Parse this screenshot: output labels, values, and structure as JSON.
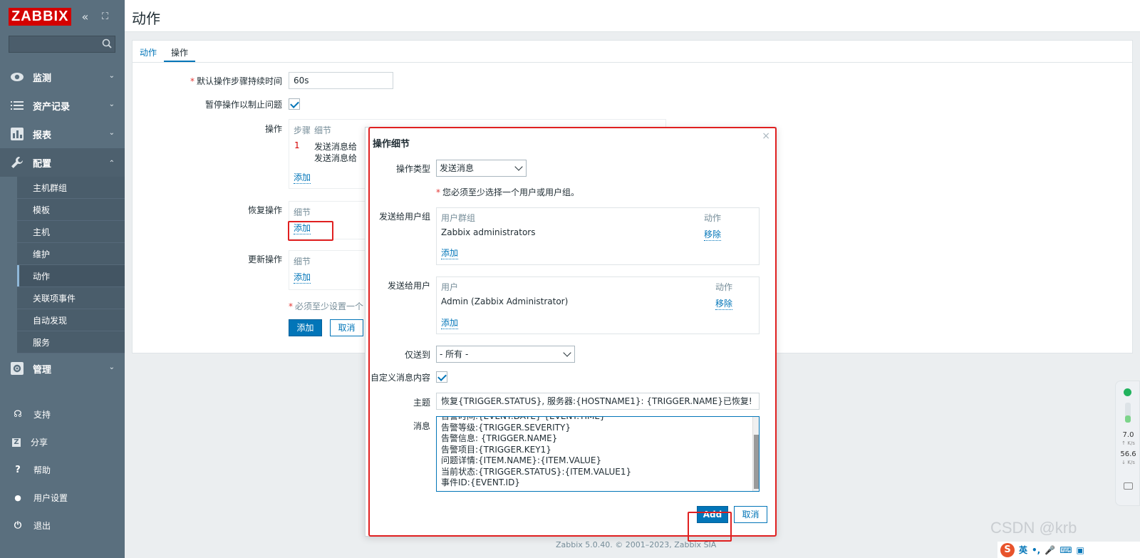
{
  "sidebar": {
    "logo": "ZABBIX",
    "collapse_glyph": "«",
    "kiosk_glyph": "⛶",
    "search_placeholder": "",
    "nav": [
      {
        "label": "监测",
        "icon": "eye-icon"
      },
      {
        "label": "资产记录",
        "icon": "list-icon"
      },
      {
        "label": "报表",
        "icon": "bar-chart-icon"
      },
      {
        "label": "配置",
        "icon": "wrench-icon"
      }
    ],
    "config_sub": [
      "主机群组",
      "模板",
      "主机",
      "维护",
      "动作",
      "关联项事件",
      "自动发现",
      "服务"
    ],
    "admin": {
      "label": "管理",
      "icon": "gear-icon"
    },
    "bottom": [
      {
        "label": "支持",
        "icon": "headset-icon",
        "glyph": "☊"
      },
      {
        "label": "分享",
        "icon": "share-z-icon",
        "glyph": "Z"
      },
      {
        "label": "帮助",
        "icon": "help-icon",
        "glyph": "?"
      },
      {
        "label": "用户设置",
        "icon": "user-icon",
        "glyph": "●"
      },
      {
        "label": "退出",
        "icon": "power-icon",
        "glyph": "⏻"
      }
    ]
  },
  "page": {
    "title": "动作"
  },
  "tabs": [
    {
      "label": "动作"
    },
    {
      "label": "操作"
    }
  ],
  "form": {
    "duration_label": "默认操作步骤持续时间",
    "duration_value": "60s",
    "pause_label": "暂停操作以制止问题",
    "ops_label": "操作",
    "ops_col_step": "步骤",
    "ops_col_detail": "细节",
    "ops_row_num": "1",
    "ops_row_line1": "发送消息给",
    "ops_row_line2": "发送消息给",
    "add_link": "添加",
    "recovery_label": "恢复操作",
    "update_label": "更新操作",
    "detail_col": "细节",
    "required_note": "必须至少设置一个",
    "add_button": "添加",
    "cancel_button": "取消"
  },
  "modal": {
    "title": "操作细节",
    "close": "×",
    "op_type_label": "操作类型",
    "op_type_value": "发送消息",
    "warning": "您必须至少选择一个用户或用户组。",
    "send_groups_label": "发送给用户组",
    "groups_col_group": "用户群组",
    "groups_col_action": "动作",
    "group_row": "Zabbix administrators",
    "remove": "移除",
    "add": "添加",
    "send_users_label": "发送给用户",
    "users_col_user": "用户",
    "users_col_action": "动作",
    "user_row": "Admin (Zabbix Administrator)",
    "only_to_label": "仅送到",
    "only_to_value": "- 所有 -",
    "custom_msg_label": "自定义消息内容",
    "subject_label": "主题",
    "subject_value": "恢复{TRIGGER.STATUS}, 服务器:{HOSTNAME1}: {TRIGGER.NAME}已恢复!",
    "message_label": "消息",
    "message_lines": [
      "告警时间:{EVENT.DATE} {EVENT.TIME}",
      "告警等级:{TRIGGER.SEVERITY}",
      "告警信息: {TRIGGER.NAME}",
      "告警项目:{TRIGGER.KEY1}",
      "问题详情:{ITEM.NAME}:{ITEM.VALUE}",
      "当前状态:{TRIGGER.STATUS}:{ITEM.VALUE1}",
      "事件ID:{EVENT.ID}"
    ],
    "add_button": "Add",
    "cancel_button": "取消"
  },
  "footer": "Zabbix 5.0.40. © 2001–2023, Zabbix SIA",
  "widget": {
    "up_value": "7.0",
    "up_unit": "↑ K/s",
    "down_value": "56.6",
    "down_unit": "↓ K/s"
  },
  "watermark": "CSDN @krb",
  "ime": {
    "logo": "S",
    "lang": "英",
    "punct": "•,"
  },
  "colors": {
    "accent": "#0275b8",
    "sidebar": "#5a6f7e",
    "highlight": "#e02020",
    "logo": "#d40000"
  }
}
